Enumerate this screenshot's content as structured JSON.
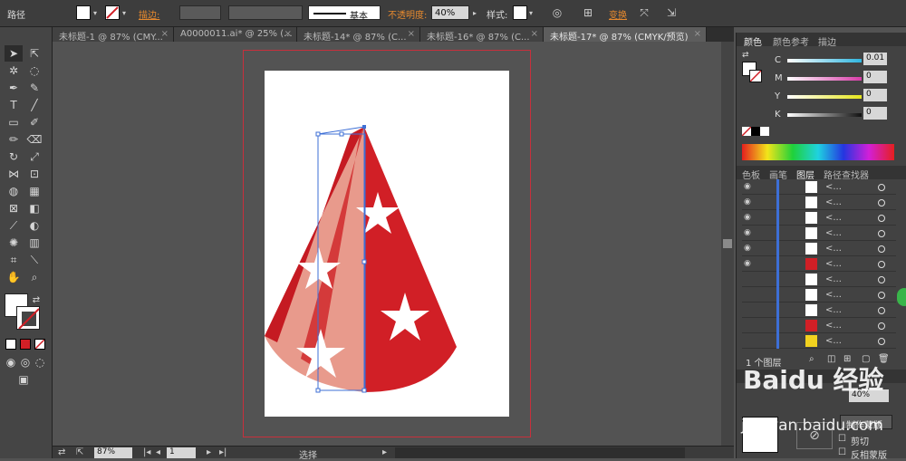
{
  "control_bar": {
    "object_label": "路径",
    "stroke_label": "描边:",
    "stroke_profile": "基本",
    "opacity_label": "不透明度:",
    "opacity_value": "40%",
    "style_label": "样式:",
    "transform_label": "变换"
  },
  "tabs": [
    {
      "label": "未标题-1 @ 87% (CMY...",
      "close": "×"
    },
    {
      "label": "A0000011.ai* @ 25% (...",
      "close": "×"
    },
    {
      "label": "未标题-14* @ 87% (C...",
      "close": "×"
    },
    {
      "label": "未标题-16* @ 87% (C...",
      "close": "×"
    },
    {
      "label": "未标题-17* @ 87% (CMYK/预览)",
      "close": "×"
    }
  ],
  "status": {
    "zoom": "87%",
    "artboard": "1",
    "mode": "选择"
  },
  "color_panel": {
    "tabs": [
      "颜色",
      "颜色参考",
      "描边"
    ],
    "channels": [
      {
        "name": "C",
        "value": "0.01",
        "color": "#2fb6e0"
      },
      {
        "name": "M",
        "value": "0",
        "color": "#d83ca8"
      },
      {
        "name": "Y",
        "value": "0",
        "color": "#e6e61c"
      },
      {
        "name": "K",
        "value": "0",
        "color": "#111111"
      }
    ]
  },
  "layers_panel": {
    "tabs": [
      "色板",
      "画笔",
      "图层",
      "路径查找器"
    ],
    "layer_count": "1 个图层",
    "rows": [
      "<...",
      "<...",
      "<...",
      "<...",
      "<...",
      "<...",
      "<...",
      "<...",
      "<...",
      "<...",
      "<..."
    ]
  },
  "transparency_panel": {
    "opacity": "40%",
    "make_mask": "制作蒙版",
    "clip": "剪切",
    "invert_mask": "反相蒙版"
  },
  "watermark": {
    "logo": "Baidu 经验",
    "url": "jingyan.baidu.com"
  },
  "colors": {
    "hat_red": "#d11f26",
    "hat_pink": "#e89a8c",
    "artboard_border": "#c8303c",
    "selection_blue": "#3d6fd6"
  }
}
